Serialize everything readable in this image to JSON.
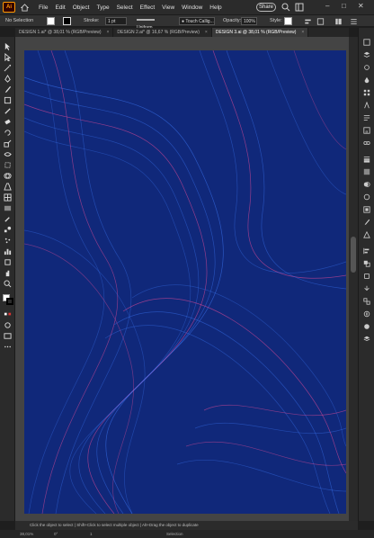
{
  "menubar": {
    "app_logo": "Ai",
    "items": [
      "File",
      "Edit",
      "Object",
      "Type",
      "Select",
      "Effect",
      "View",
      "Window",
      "Help"
    ],
    "share_label": "Share"
  },
  "controlbar": {
    "selection": "No Selection",
    "stroke_label": "Stroke:",
    "stroke_value": "1 pt",
    "profile": "Uniform",
    "brush": "Touch Callig...",
    "opacity_label": "Opacity:",
    "opacity_value": "100%",
    "style_label": "Style:"
  },
  "tabs": [
    {
      "label": "DESIGN 1.ai* @ 38,01 % (RGB/Preview)",
      "close": "×"
    },
    {
      "label": "DESIGN 2.ai* @ 16,67 % (RGB/Preview)",
      "close": "×"
    },
    {
      "label": "DESIGN 3.ai @ 38,01 % (RGB/Preview)",
      "close": "×"
    }
  ],
  "statusbar": {
    "text": "Click the object to select  |  Shift+Click to select multiple object  |  Alt+Drag the object to duplicate"
  },
  "bottombar": {
    "zoom": "38,01%",
    "rotation": "0°",
    "artboard": "1",
    "mode": "Selection"
  },
  "colors": {
    "artboard_bg": "#0f2a7a",
    "accent_pink": "#ff4f9b",
    "line_blue": "#3f7dff"
  }
}
